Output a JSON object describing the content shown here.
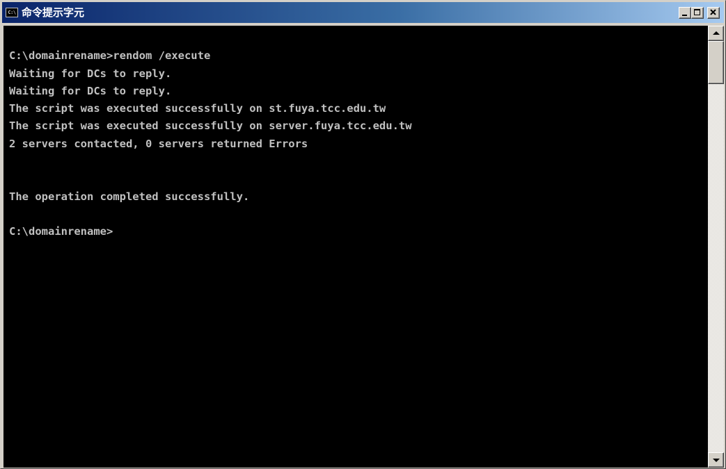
{
  "window": {
    "title": "命令提示字元",
    "icon": "cmd-icon",
    "icon_text": "C:\\",
    "controls": [
      "minimize-icon",
      "maximize-icon",
      "close-icon"
    ]
  },
  "console": {
    "lines": [
      "",
      "C:\\domainrename>rendom /execute",
      "Waiting for DCs to reply.",
      "Waiting for DCs to reply.",
      "The script was executed successfully on st.fuya.tcc.edu.tw",
      "The script was executed successfully on server.fuya.tcc.edu.tw",
      "2 servers contacted, 0 servers returned Errors",
      "",
      "",
      "The operation completed successfully.",
      "",
      "C:\\domainrename>"
    ],
    "colors": {
      "background": "#000000",
      "text": "#c0c0c0"
    }
  },
  "colors": {
    "title_gradient_start": "#0a246a",
    "title_gradient_end": "#a6caf0",
    "chrome": "#d4d0c8"
  }
}
